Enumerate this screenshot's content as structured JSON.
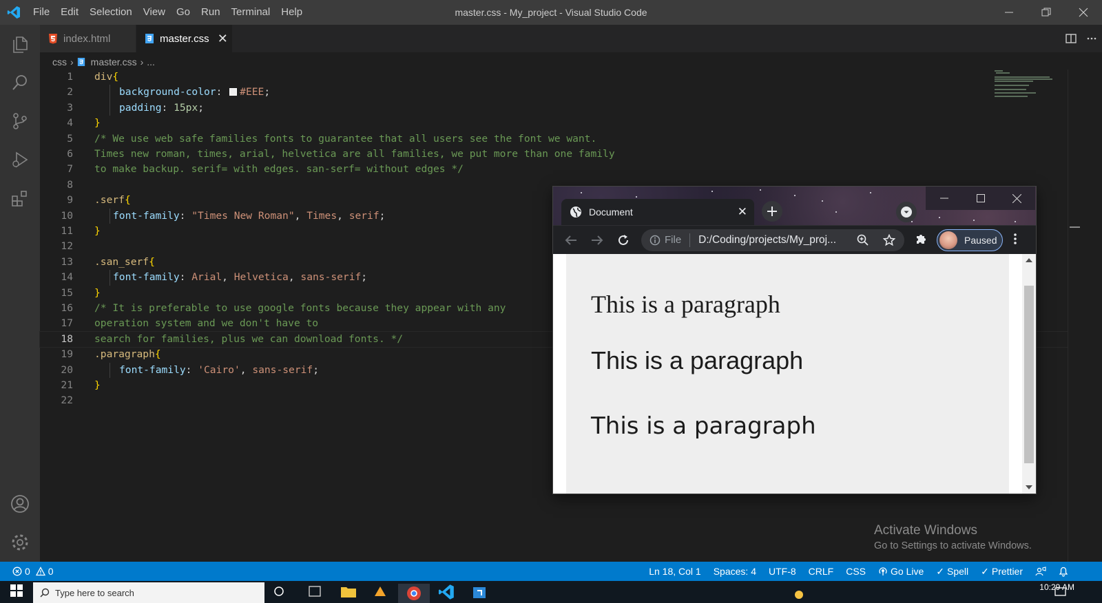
{
  "titlebar": {
    "menu": [
      "File",
      "Edit",
      "Selection",
      "View",
      "Go",
      "Run",
      "Terminal",
      "Help"
    ],
    "window_title": "master.css - My_project - Visual Studio Code"
  },
  "tabs": [
    {
      "label": "index.html",
      "icon": "html5-file-icon",
      "active": false
    },
    {
      "label": "master.css",
      "icon": "css3-file-icon",
      "active": true,
      "close": "✕"
    }
  ],
  "breadcrumb": {
    "folder": "css",
    "file": "master.css",
    "tail": "..."
  },
  "editor": {
    "current_line": 18,
    "lines": [
      {
        "n": "1"
      },
      {
        "n": "2"
      },
      {
        "n": "3"
      },
      {
        "n": "4"
      },
      {
        "n": "5"
      },
      {
        "n": "6"
      },
      {
        "n": "7"
      },
      {
        "n": "8"
      },
      {
        "n": "9"
      },
      {
        "n": "10"
      },
      {
        "n": "11"
      },
      {
        "n": "12"
      },
      {
        "n": "13"
      },
      {
        "n": "14"
      },
      {
        "n": "15"
      },
      {
        "n": "16"
      },
      {
        "n": "17"
      },
      {
        "n": "18"
      },
      {
        "n": "19"
      },
      {
        "n": "20"
      },
      {
        "n": "21"
      },
      {
        "n": "22"
      }
    ],
    "code": {
      "l1_sel": "div",
      "l1_brace": "{",
      "l2_prop": "background-color",
      "l2_val": "#EEE",
      "l3_prop": "padding",
      "l3_val": "15px",
      "l4_brace": "}",
      "l5": "/* We use web safe families fonts to guarantee that all users see the font we want.",
      "l6": "Times new roman, times, arial, helvetica are all families, we put more than one family",
      "l7": "to make backup. serif= with edges. san-serf= without edges */",
      "l9_sel": ".serf",
      "l10_prop": "font-family",
      "l10_v1": "\"Times New Roman\"",
      "l10_v2": "Times",
      "l10_v3": "serif",
      "l13_sel": ".san_serf",
      "l14_prop": "font-family",
      "l14_v1": "Arial",
      "l14_v2": "Helvetica",
      "l14_v3": "sans-serif",
      "l16": "/* It is preferable to use google fonts because they appear with any",
      "l17": "operation system and we don't have to",
      "l18": "search for families, plus we can download fonts. */",
      "l19_sel": ".paragraph",
      "l20_prop": "font-family",
      "l20_v1": "'Cairo'",
      "l20_v2": "sans-serif"
    }
  },
  "statusbar": {
    "errors": "0",
    "warnings": "0",
    "position": "Ln 18, Col 1",
    "spaces": "Spaces: 4",
    "encoding": "UTF-8",
    "eol": "CRLF",
    "language": "CSS",
    "golive": "Go Live",
    "spell": "Spell",
    "prettier": "Prettier"
  },
  "watermark": {
    "line1": "Activate Windows",
    "line2": "Go to Settings to activate Windows."
  },
  "browser": {
    "tab_title": "Document",
    "scheme_label": "File",
    "url": "D:/Coding/projects/My_proj...",
    "profile_status": "Paused",
    "page": {
      "background": "#EEEEEE",
      "paragraphs": [
        "This is a paragraph",
        "This is a paragraph",
        "This is a paragraph"
      ]
    }
  },
  "taskbar": {
    "search_placeholder": "Type here to search",
    "time": "10:29 AM"
  },
  "colors": {
    "statusbar": "#007acc",
    "titlebar": "#3c3c3c",
    "activitybar": "#333333",
    "editor_bg": "#1e1e1e"
  }
}
